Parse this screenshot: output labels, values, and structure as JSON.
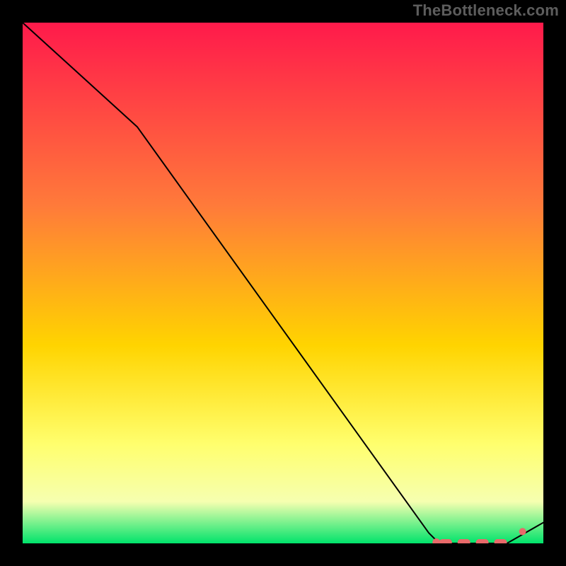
{
  "watermark": "TheBottleneck.com",
  "colors": {
    "grad_top": "#ff1a4b",
    "grad_mid1": "#ff7a3a",
    "grad_mid2": "#ffd400",
    "grad_mid3": "#ffff6e",
    "grad_mid4": "#f6ffb0",
    "grad_bot": "#00e36b",
    "line": "#000000",
    "badge": "#e86a6a"
  },
  "chart_data": {
    "type": "line",
    "title": "",
    "xlabel": "",
    "ylabel": "",
    "x": [
      0,
      22,
      78,
      80,
      86,
      93,
      100
    ],
    "values": [
      100,
      80,
      2,
      0,
      0,
      0,
      4
    ],
    "xlim": [
      0,
      100
    ],
    "ylim": [
      0,
      100
    ],
    "flat_band": {
      "x_from": 80,
      "x_to": 93,
      "y": 0
    }
  }
}
